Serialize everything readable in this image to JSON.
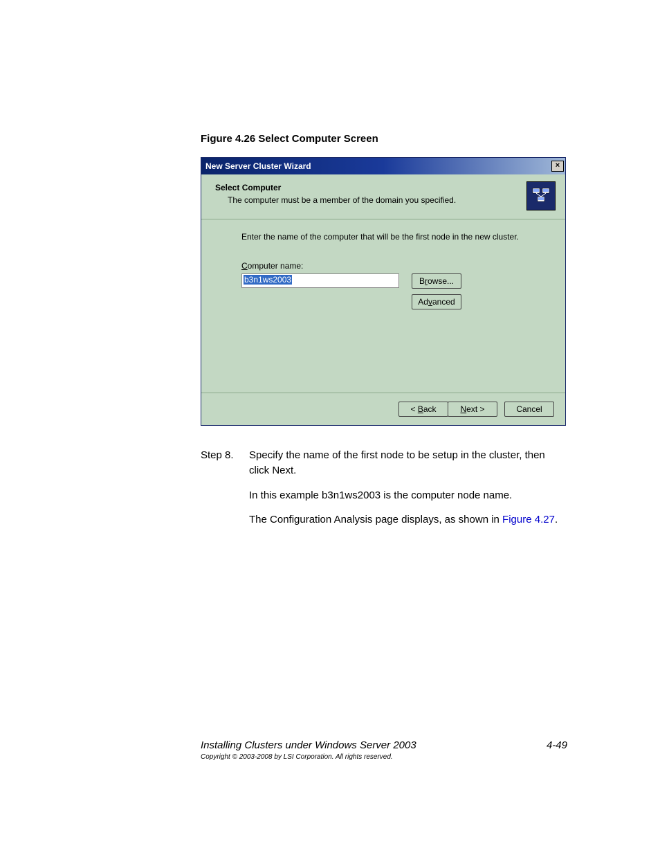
{
  "figure_caption": "Figure 4.26   Select Computer Screen",
  "dialog": {
    "title": "New Server Cluster Wizard",
    "close": "×",
    "header_title": "Select Computer",
    "header_sub": "The computer must be a member of the domain you specified.",
    "instruction": "Enter the name of the computer that will be the first node in the new cluster.",
    "field_label_pre": "C",
    "field_label_post": "omputer name:",
    "input_value": "b3n1ws2003",
    "browse_pre": "B",
    "browse_u": "r",
    "browse_post": "owse...",
    "advanced_pre": "Ad",
    "advanced_u": "v",
    "advanced_post": "anced",
    "back_pre": "< ",
    "back_u": "B",
    "back_post": "ack",
    "next_u": "N",
    "next_post": "ext >",
    "cancel": "Cancel"
  },
  "step": {
    "label": "Step 8.",
    "p1": "Specify the name of the first node to be setup in the cluster, then click Next.",
    "p2": "In this example b3n1ws2003 is the computer node name.",
    "p3a": "The Configuration Analysis page displays, as shown in ",
    "p3link": "Figure 4.27",
    "p3b": "."
  },
  "footer": {
    "title": "Installing Clusters under Windows Server 2003",
    "page": "4-49",
    "copyright": "Copyright © 2003-2008 by LSI Corporation. All rights reserved."
  }
}
